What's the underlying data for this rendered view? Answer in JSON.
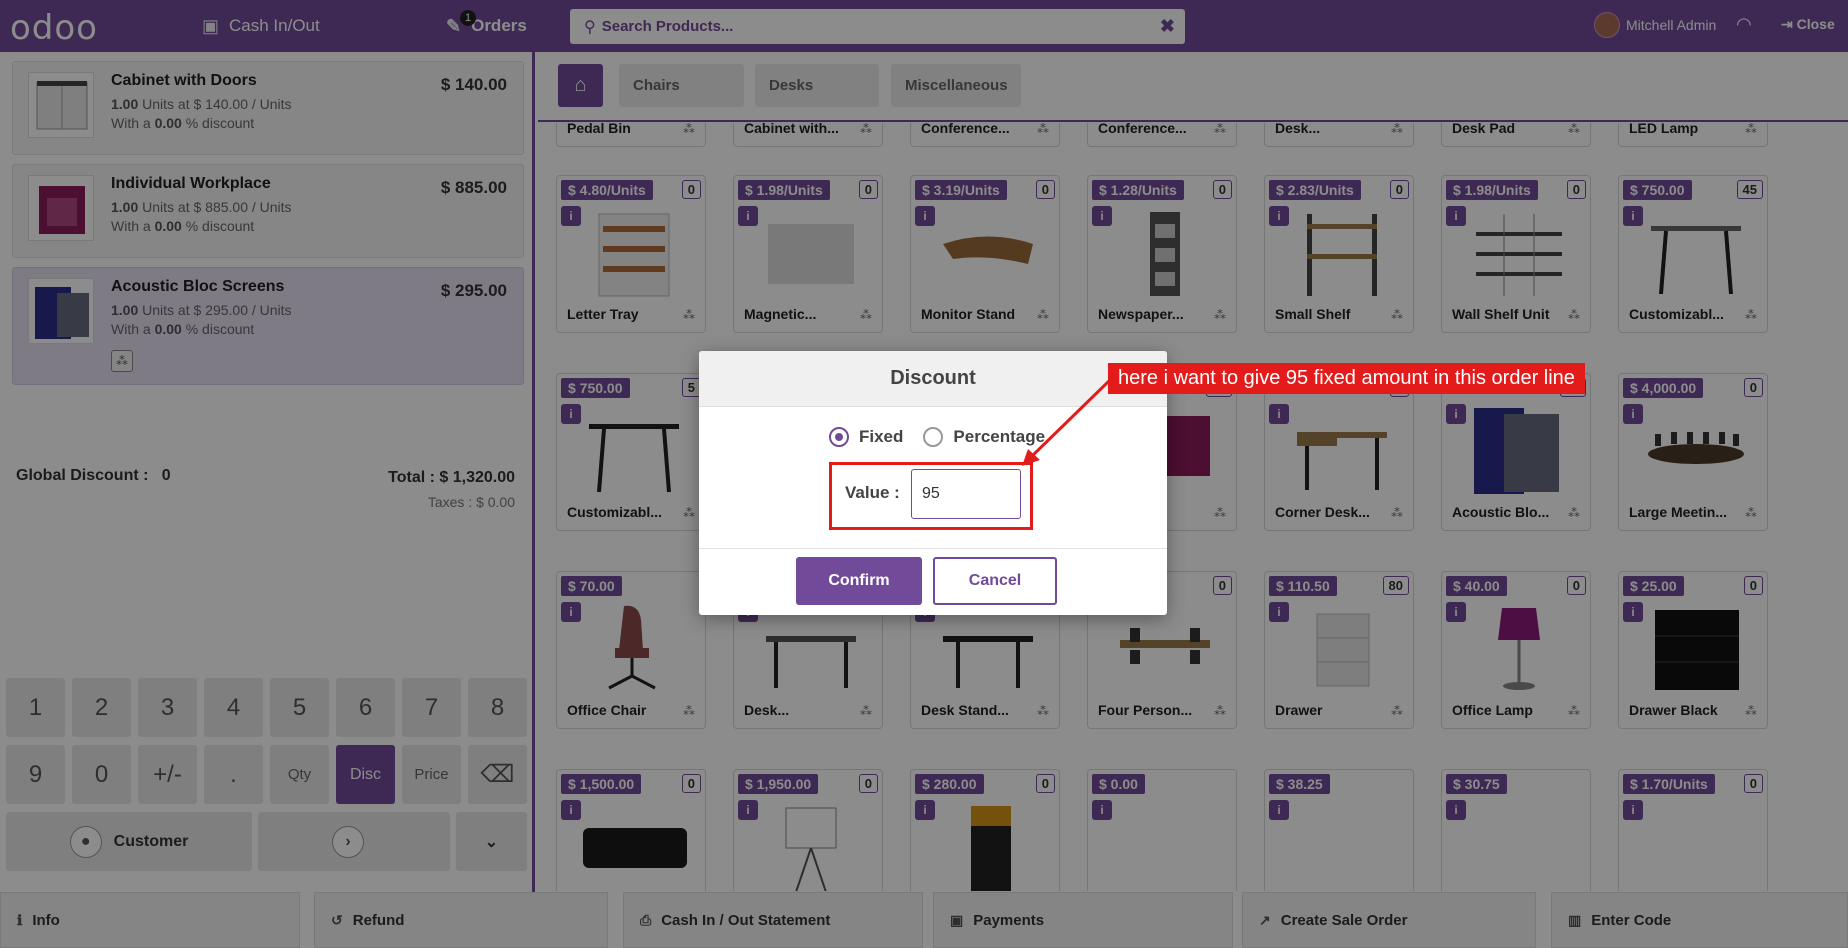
{
  "topbar": {
    "logo": "odoo",
    "cash_in_out": "Cash In/Out",
    "orders": "Orders",
    "orders_badge": "1",
    "search_placeholder": "Search Products...",
    "user": "Mitchell Admin",
    "close": "Close"
  },
  "order_lines": [
    {
      "name": "Cabinet with Doors",
      "price": "$ 140.00",
      "qty": "1.00",
      "detail": "Units at $ 140.00 / Units",
      "discount": "0.00",
      "discount_text": "% discount"
    },
    {
      "name": "Individual Workplace",
      "price": "$ 885.00",
      "qty": "1.00",
      "detail": "Units at $ 885.00 / Units",
      "discount": "0.00",
      "discount_text": "% discount"
    },
    {
      "name": "Acoustic Bloc Screens",
      "price": "$ 295.00",
      "qty": "1.00",
      "detail": "Units at $ 295.00 / Units",
      "discount": "0.00",
      "discount_text": "% discount"
    }
  ],
  "with_a": "With a",
  "summary": {
    "global_discount_label": "Global Discount :",
    "global_discount_value": "0",
    "total": "Total : $ 1,320.00",
    "taxes": "Taxes : $ 0.00"
  },
  "numpad": {
    "row1": [
      "1",
      "2",
      "3",
      "4",
      "5",
      "6",
      "7",
      "8"
    ],
    "row2": [
      "9",
      "0",
      "+/-",
      ".",
      "Qty",
      "Disc",
      "Price"
    ],
    "customer": "Customer"
  },
  "categories": [
    "Chairs",
    "Desks",
    "Miscellaneous"
  ],
  "products_row0": [
    "Pedal Bin",
    "Cabinet with...",
    "Conference...",
    "Conference...",
    "Desk...",
    "Desk Pad",
    "LED Lamp"
  ],
  "products": [
    {
      "name": "Letter Tray",
      "price": "$ 4.80/Units",
      "qty": "0"
    },
    {
      "name": "Magnetic...",
      "price": "$ 1.98/Units",
      "qty": "0"
    },
    {
      "name": "Monitor Stand",
      "price": "$ 3.19/Units",
      "qty": "0"
    },
    {
      "name": "Newspaper...",
      "price": "$ 1.28/Units",
      "qty": "0"
    },
    {
      "name": "Small Shelf",
      "price": "$ 2.83/Units",
      "qty": "0"
    },
    {
      "name": "Wall Shelf Unit",
      "price": "$ 1.98/Units",
      "qty": "0"
    },
    {
      "name": "Customizabl...",
      "price": "$ 750.00",
      "qty": "45"
    },
    {
      "name": "Customizabl...",
      "price": "$ 750.00",
      "qty": "5"
    },
    {
      "name": "",
      "price": "",
      "qty": ""
    },
    {
      "name": "",
      "price": "",
      "qty": ""
    },
    {
      "name": "...",
      "price": "",
      "qty": "10"
    },
    {
      "name": "Corner Desk...",
      "price": "",
      "qty": "2"
    },
    {
      "name": "Acoustic Blo...",
      "price": "",
      "qty": "10"
    },
    {
      "name": "Large Meetin...",
      "price": "$ 4,000.00",
      "qty": "0"
    },
    {
      "name": "Office Chair",
      "price": "$ 70.00",
      "qty": ""
    },
    {
      "name": "Desk...",
      "price": "",
      "qty": ""
    },
    {
      "name": "Desk Stand...",
      "price": "",
      "qty": ""
    },
    {
      "name": "Four Person...",
      "price": "",
      "qty": "0"
    },
    {
      "name": "Drawer",
      "price": "$ 110.50",
      "qty": "80"
    },
    {
      "name": "Office Lamp",
      "price": "$ 40.00",
      "qty": "0"
    },
    {
      "name": "Drawer Black",
      "price": "$ 25.00",
      "qty": "0"
    },
    {
      "name": "",
      "price": "$ 1,500.00",
      "qty": "0"
    },
    {
      "name": "",
      "price": "$ 1,950.00",
      "qty": "0"
    },
    {
      "name": "",
      "price": "$ 280.00",
      "qty": "0"
    },
    {
      "name": "",
      "price": "$ 0.00",
      "qty": ""
    },
    {
      "name": "",
      "price": "$ 38.25",
      "qty": ""
    },
    {
      "name": "",
      "price": "$ 30.75",
      "qty": ""
    },
    {
      "name": "",
      "price": "$ 1.70/Units",
      "qty": "0"
    }
  ],
  "bottombar": [
    "Info",
    "Refund",
    "Cash In / Out Statement",
    "Payments",
    "Create Sale Order",
    "Enter Code"
  ],
  "dialog": {
    "title": "Discount",
    "fixed": "Fixed",
    "percentage": "Percentage",
    "selected": "Fixed",
    "value_label": "Value :",
    "value": "95",
    "confirm": "Confirm",
    "cancel": "Cancel"
  },
  "annotation": "here i want to give 95 fixed amount in this order line",
  "colors": {
    "brand": "#714B9A",
    "annotation": "#e31b1b"
  }
}
